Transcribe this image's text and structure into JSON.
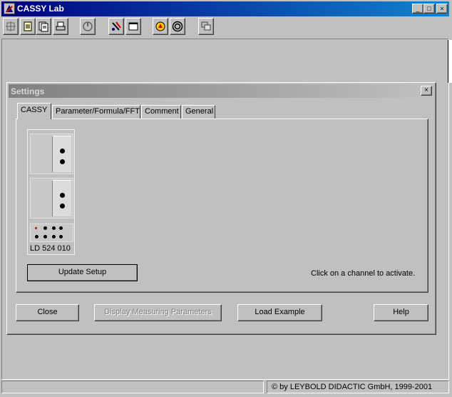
{
  "window": {
    "title": "CASSY Lab",
    "controls": [
      "_",
      "□",
      "×"
    ]
  },
  "toolbar": {
    "tools": [
      "start-icon",
      "open-icon",
      "save-icon",
      "print-icon",
      "measure-icon",
      "settings-icon",
      "window-icon",
      "help-icon",
      "ld-icon",
      "tile-icon"
    ]
  },
  "dialog": {
    "title": "Settings",
    "close": "×",
    "tabs": [
      "CASSY",
      "Parameter/Formula/FFT",
      "Comment",
      "General"
    ],
    "active_tab": "CASSY",
    "module": {
      "label": "LD  524 010"
    },
    "update_button": "Update Setup",
    "hint": "Click on a channel to activate.",
    "buttons": {
      "close": "Close",
      "display": "Display Measuring Parameters",
      "load": "Load Example",
      "help": "Help"
    }
  },
  "status": {
    "copyright": "© by LEYBOLD DIDACTIC GmbH, 1999-2001"
  },
  "colors": {
    "titlebar_active": "#000080",
    "titlebar_inactive": "#808080",
    "face": "#c0c0c0",
    "led": "#d00000"
  }
}
